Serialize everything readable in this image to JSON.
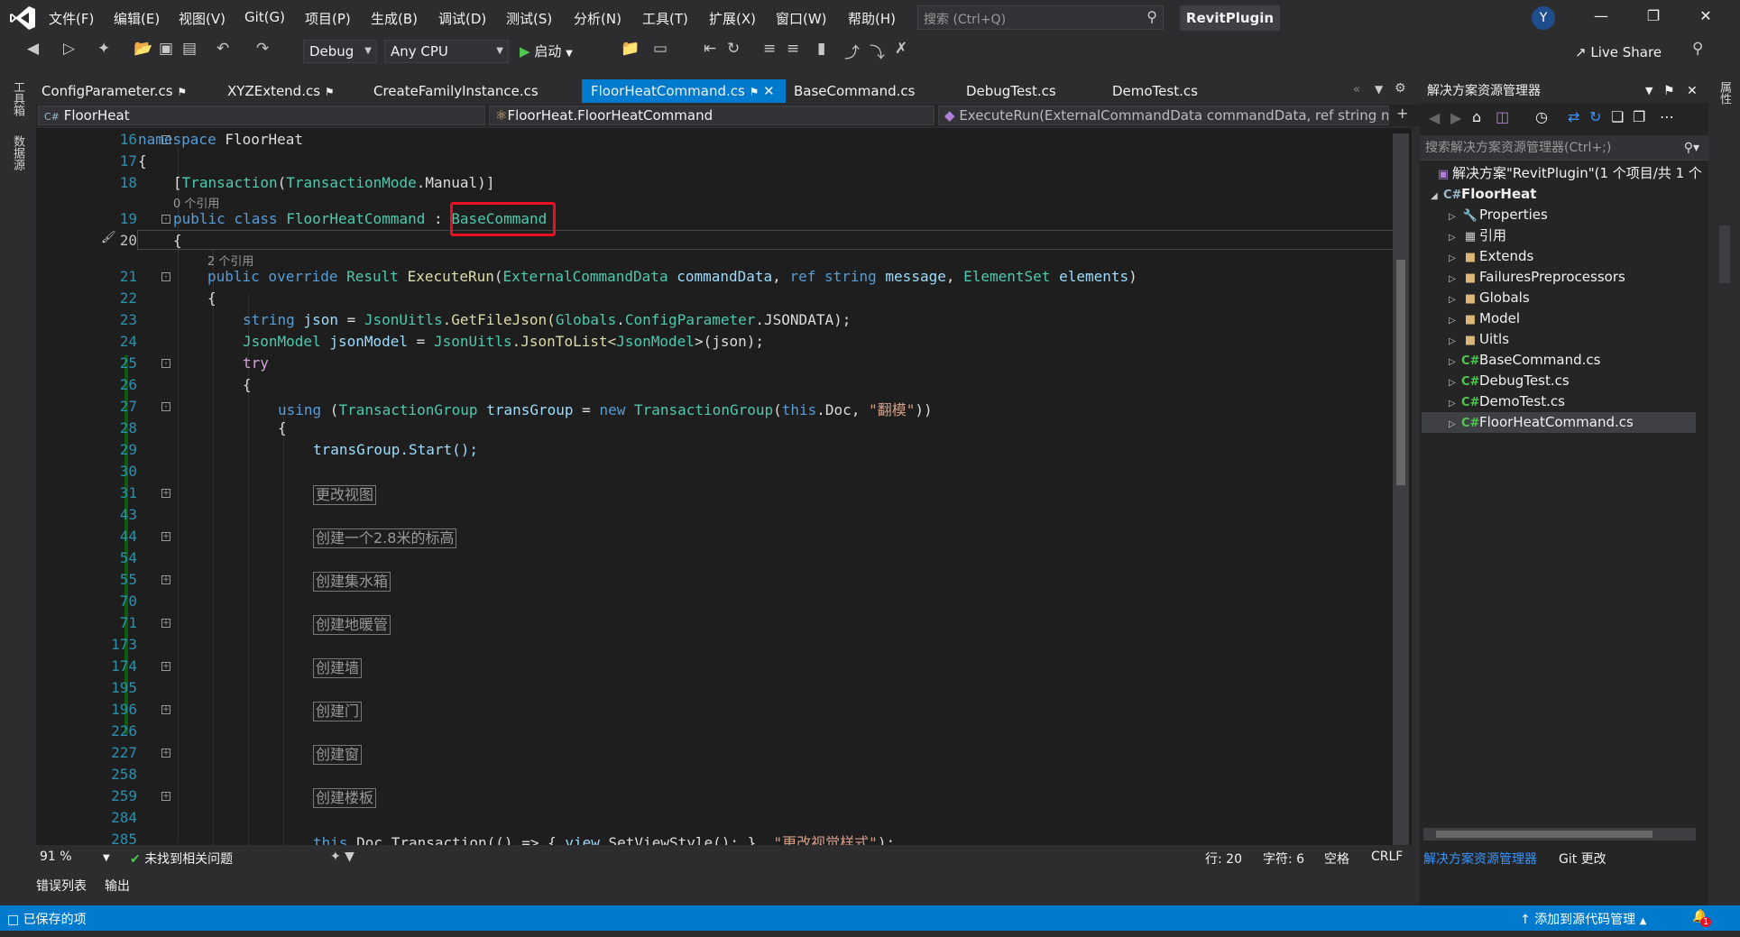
{
  "menu": [
    "文件(F)",
    "编辑(E)",
    "视图(V)",
    "Git(G)",
    "项目(P)",
    "生成(B)",
    "调试(D)",
    "测试(S)",
    "分析(N)",
    "工具(T)",
    "扩展(X)",
    "窗口(W)",
    "帮助(H)"
  ],
  "search": {
    "placeholder": "搜索 (Ctrl+Q)"
  },
  "title": "RevitPlugin",
  "avatar": "Y",
  "toolbar": {
    "config": "Debug",
    "platform": "Any CPU",
    "start": "启动",
    "live_share": "Live Share"
  },
  "left_strip": [
    "工具箱",
    "数据源"
  ],
  "tabs": [
    "ConfigParameter.cs",
    "XYZExtend.cs",
    "CreateFamilyInstance.cs",
    "FloorHeatCommand.cs",
    "BaseCommand.cs",
    "DebugTest.cs",
    "DemoTest.cs"
  ],
  "nav": {
    "project": "FloorHeat",
    "class": "FloorHeat.FloorHeatCommand",
    "member": "ExecuteRun(ExternalCommandData commandData, ref string n"
  },
  "lines": [
    "16",
    "17",
    "18",
    "19",
    "20",
    "21",
    "22",
    "23",
    "24",
    "25",
    "26",
    "27",
    "28",
    "29",
    "30",
    "31",
    "43",
    "44",
    "54",
    "55",
    "70",
    "71",
    "173",
    "174",
    "195",
    "196",
    "226",
    "227",
    "258",
    "259",
    "284",
    "285"
  ],
  "lens": {
    "ref0": "0 个引用",
    "ref2": "2 个引用"
  },
  "collapsed": [
    "更改视图",
    "创建一个2.8米的标高",
    "创建集水箱",
    "创建地暖管",
    "创建墙",
    "创建门",
    "创建窗",
    "创建楼板"
  ],
  "code": {
    "namespace": "namespace",
    "ns_name": " FloorHeat",
    "attr_open": "[",
    "attr_type": "Transaction",
    "attr_mid": "(",
    "attr_enum": "TransactionMode",
    "attr_end": ".Manual)]",
    "public": "public",
    "class": " class",
    "class_name": " FloorHeatCommand",
    "colon": " : ",
    "base": "BaseCommand",
    "override": " override",
    "result": " Result",
    "method": " ExecuteRun",
    "p1t": "ExternalCommandData",
    "p1": " commandData",
    "ref": "ref",
    "string": " string",
    "p2": " message",
    "p3t": "ElementSet",
    "p3": " elements",
    "l23_string": "string",
    "l23_json": " json",
    "l23_eq": " = ",
    "l23_cls": "JsonUitls",
    "l23_call": ".GetFileJson(",
    "l23_glob": "Globals",
    "l23_dot": ".",
    "l23_cp": "ConfigParameter",
    "l23_end": ".JSONDATA);",
    "l24_type": "JsonModel",
    "l24_var": " jsonModel",
    "l24_eq": " = ",
    "l24_cls": "JsonUitls",
    "l24_call": ".JsonToList<",
    "l24_gen": "JsonModel",
    "l24_end": ">(json);",
    "try": "try",
    "using": "using",
    "tg": "TransactionGroup",
    "tg_var": " transGroup",
    "new": "new",
    "this": "this",
    "doc": ".Doc, ",
    "str": "\"翻模\"",
    "close": "))",
    "start": "transGroup.Start();",
    "last_this": "this",
    "last_a": ".Doc.Transaction(() => { ",
    "last_b": "view",
    "last_c": ".SetViewStyle(); }, ",
    "last_str": "\"更改视觉样式\"",
    "last_end": ");"
  },
  "status": {
    "zoom": "91 %",
    "issues": "未找到相关问题",
    "line": "行: 20",
    "char": "字符: 6",
    "space": "空格",
    "crlf": "CRLF"
  },
  "bottom_tabs": [
    "错误列表",
    "输出"
  ],
  "statusbar": {
    "left": "已保存的项",
    "right": "添加到源代码管理",
    "badge": "1"
  },
  "solution": {
    "title": "解决方案资源管理器",
    "search": "搜索解决方案资源管理器(Ctrl+;)",
    "root": "解决方案\"RevitPlugin\"(1 个项目/共 1 个",
    "project": "FloorHeat",
    "items": [
      "Properties",
      "引用",
      "Extends",
      "FailuresPreprocessors",
      "Globals",
      "Model",
      "Uitls",
      "BaseCommand.cs",
      "DebugTest.cs",
      "DemoTest.cs",
      "FloorHeatCommand.cs"
    ],
    "tabs": [
      "解决方案资源管理器",
      "Git 更改"
    ]
  },
  "right_strip": "属性"
}
